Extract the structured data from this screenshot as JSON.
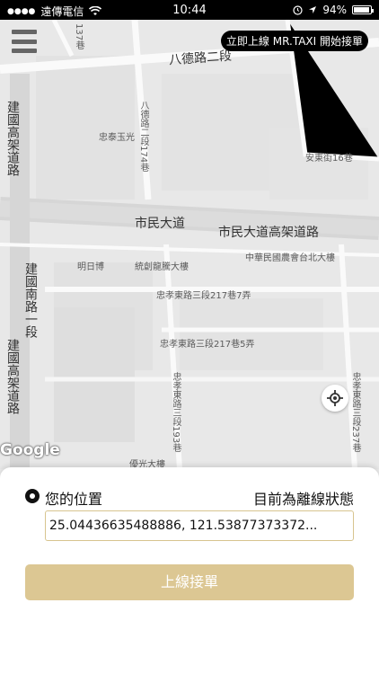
{
  "status_bar": {
    "carrier": "遠傳電信",
    "time": "10:44",
    "battery": "94%"
  },
  "map": {
    "banner": "立即上線 MR.TAXI 開始接單",
    "labels": {
      "lane_137": "137巷",
      "bade_road_2": "八德路二段",
      "lane_174": "八德路二段174巷",
      "zhongtai": "忠泰玉光",
      "anzhong_16": "安東街16巷",
      "elevated_jianguo": "建國高架道路",
      "civic_blvd": "市民大道",
      "civic_elevated": "市民大道高架道路",
      "mingribo": "明日博",
      "tongchuang": "統創龍騰大樓",
      "farmers_bldg": "中華民國農會台北大樓",
      "jianguo_south_1": "建國南路一段",
      "zhongxiao_217_7": "忠孝東路三段217巷7弄",
      "zhongxiao_217_5": "忠孝東路三段217巷5弄",
      "elevated_jianguo_2": "建國高架道路",
      "zhongxiao_193": "忠孝東路三段193巷",
      "zhongxiao_237": "忠孝東路三段237巷",
      "youguang": "優光大樓"
    },
    "google": "Google"
  },
  "sheet": {
    "location_label": "您的位置",
    "status_text": "目前為離線狀態",
    "coordinates": "25.04436635488886, 121.53877373372...",
    "online_button": "上線接單"
  },
  "colors": {
    "accent": "#dcc793",
    "field_border": "#d7c48f"
  },
  "icons": [
    "wifi-icon",
    "menu-icon",
    "locate-icon",
    "location-dot-icon",
    "location-arrow-icon",
    "alarm-icon"
  ]
}
